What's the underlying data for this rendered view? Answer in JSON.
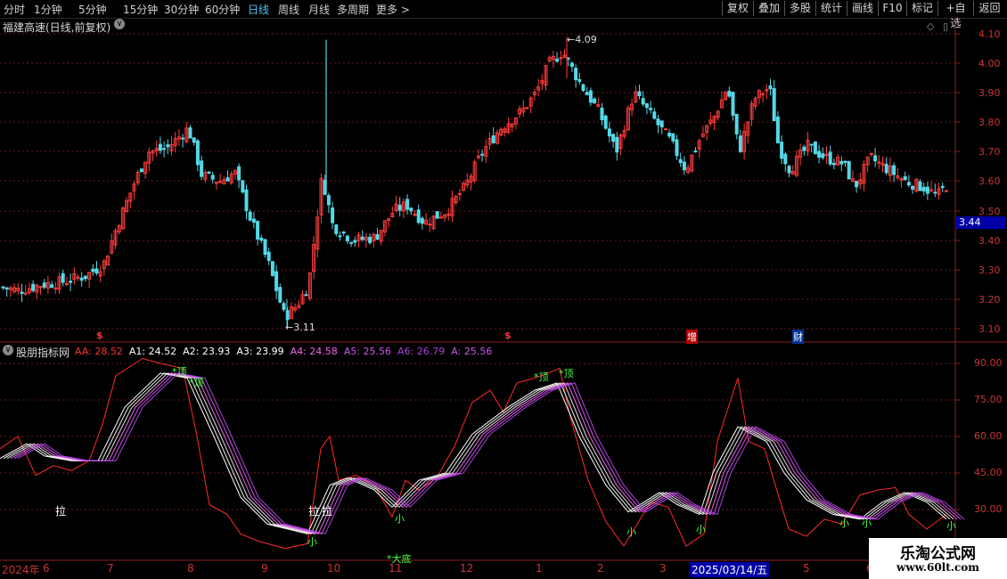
{
  "toolbar": {
    "periods": [
      "分时",
      "1分钟",
      "5分钟",
      "15分钟",
      "30分钟",
      "60分钟",
      "日线",
      "周线",
      "月线",
      "多周期",
      "更多 >"
    ],
    "active_period": "日线",
    "buttons": [
      "复权",
      "叠加",
      "多股",
      "统计",
      "画线",
      "F10",
      "标记",
      "+自选",
      "返回"
    ]
  },
  "main": {
    "title": "福建高速(日线,前复权)",
    "high_label": "4.09",
    "low_label": "3.11",
    "current_price": "3.44",
    "y_ticks": [
      "4.10",
      "4.00",
      "3.90",
      "3.80",
      "3.70",
      "3.60",
      "3.50",
      "3.40",
      "3.30",
      "3.20",
      "3.10"
    ],
    "markers": [
      {
        "text": "$",
        "color": "#ff3030"
      },
      {
        "text": "$",
        "color": "#ff3030"
      },
      {
        "text": "增",
        "color": "#ffffff",
        "bg": "#b00000"
      },
      {
        "text": "财",
        "color": "#ffffff",
        "bg": "#003399"
      }
    ],
    "colors": {
      "up": "#ff3c3c",
      "down": "#54d8e8",
      "grid": "#6a1a1a"
    }
  },
  "indicator": {
    "name": "股朋指标网",
    "values": [
      {
        "label": "AA:",
        "value": "28.52",
        "color": "#ff3030"
      },
      {
        "label": "A1:",
        "value": "24.52",
        "color": "#ffffff"
      },
      {
        "label": "A2:",
        "value": "23.93",
        "color": "#ffffff"
      },
      {
        "label": "A3:",
        "value": "23.99",
        "color": "#ffffff"
      },
      {
        "label": "A4:",
        "value": "24.58",
        "color": "#ee66ee"
      },
      {
        "label": "A5:",
        "value": "25.56",
        "color": "#cc55ee"
      },
      {
        "label": "A6:",
        "value": "26.79",
        "color": "#aa44dd"
      },
      {
        "label": "A:",
        "value": "25.56",
        "color": "#cc55ee"
      }
    ],
    "y_ticks": [
      "90.00",
      "75.00",
      "60.00",
      "45.00",
      "30.00"
    ],
    "signals": {
      "top": "*顶",
      "bottom": "*大底",
      "small": "小",
      "pull": "拉"
    }
  },
  "xaxis": {
    "labels": [
      "2024年",
      "6",
      "7",
      "8",
      "9",
      "10",
      "11",
      "12",
      "1",
      "2",
      "3",
      "2025/03/14/五",
      "5",
      "6"
    ]
  },
  "watermark": {
    "line1": "乐淘公式网",
    "line2": "www.60lt.com"
  }
}
